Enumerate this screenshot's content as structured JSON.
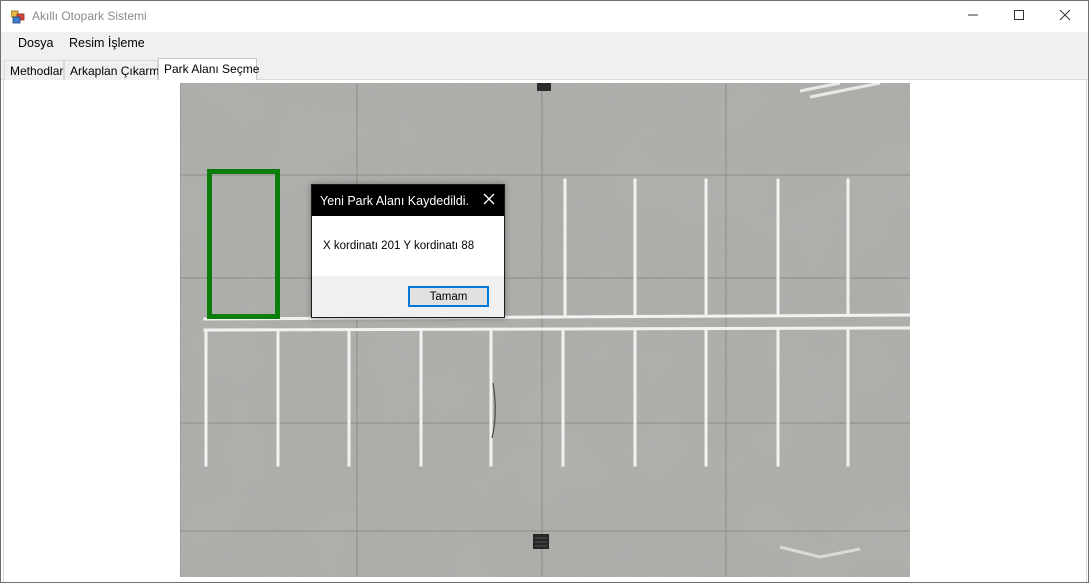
{
  "window": {
    "title": "Akıllı Otopark Sistemi",
    "icon": "app-icon",
    "controls": [
      "minimize-icon",
      "maximize-icon",
      "close-icon"
    ]
  },
  "menu": {
    "items": [
      {
        "label": "Dosya"
      },
      {
        "label": "Resim İşleme"
      }
    ]
  },
  "tabs": [
    {
      "label": "Methodlar",
      "active": false
    },
    {
      "label": "Arkaplan Çıkarma",
      "active": false
    },
    {
      "label": "Park Alanı Seçme",
      "active": true
    }
  ],
  "canvas": {
    "image": "parking-lot-aerial-photo",
    "selection_color": "#0b7d0b"
  },
  "dialog": {
    "title": "Yeni Park Alanı Kaydedildi.",
    "message": "X kordinatı 201 Y kordinatı 88",
    "ok_label": "Tamam",
    "accent": "#0078d7"
  }
}
